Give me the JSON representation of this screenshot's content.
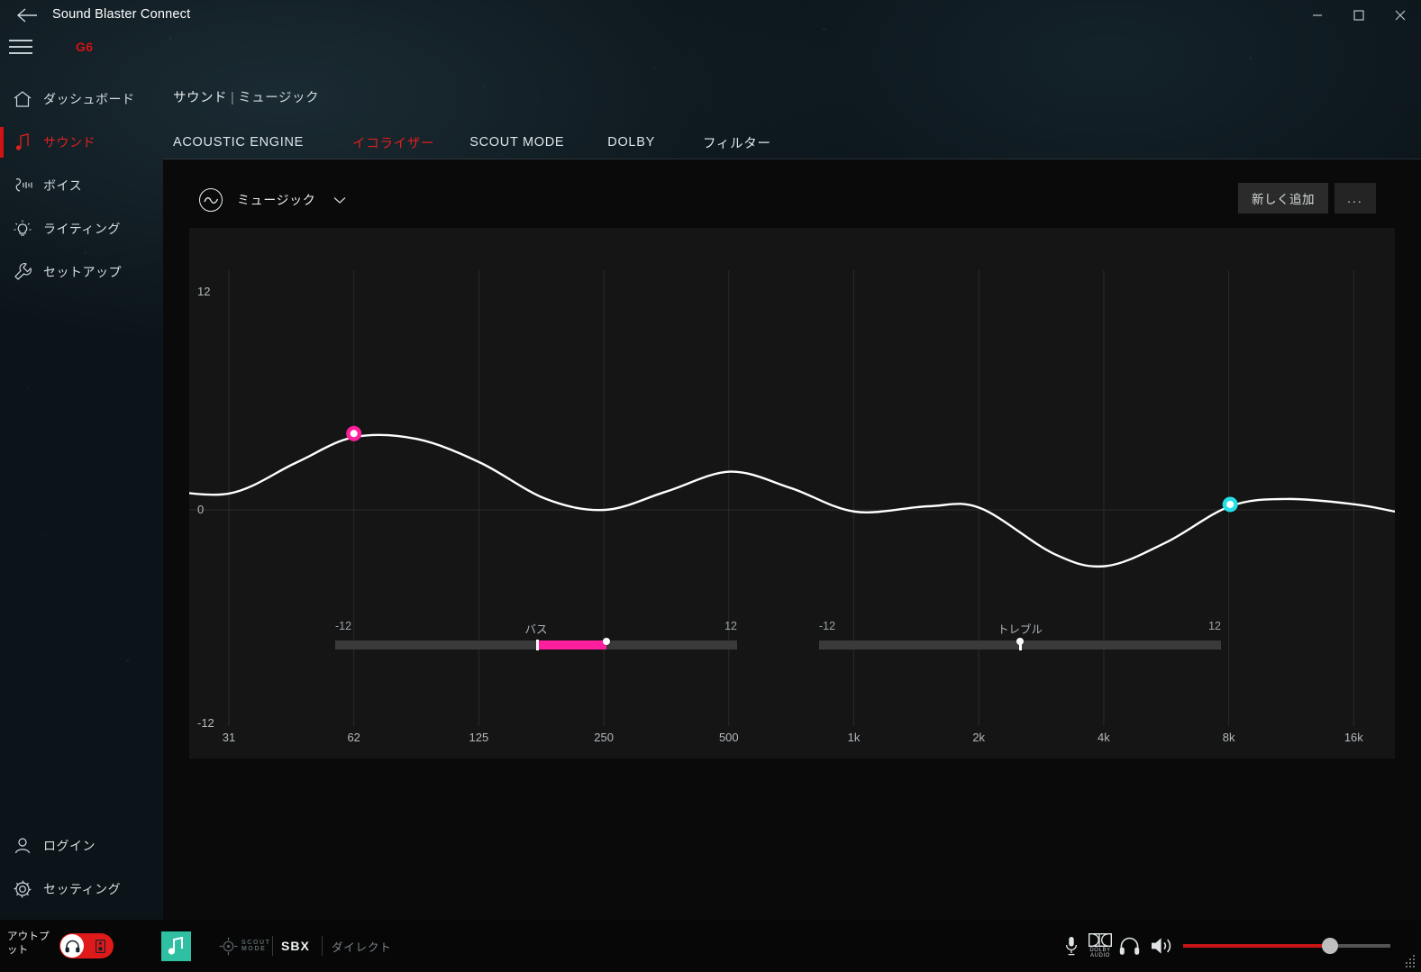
{
  "titlebar": {
    "app_title": "Sound Blaster Connect",
    "back_icon": "back-arrow-icon",
    "minimize": "–",
    "maximize": "□",
    "close": "✕"
  },
  "topbar": {
    "menu_icon": "hamburger-menu-icon",
    "device_label": "G6"
  },
  "sidebar": {
    "items": [
      {
        "label": "ダッシュボード",
        "icon": "home-icon",
        "active": false
      },
      {
        "label": "サウンド",
        "icon": "music-note-icon",
        "active": true
      },
      {
        "label": "ボイス",
        "icon": "microphone-wave-icon",
        "active": false
      },
      {
        "label": "ライティング",
        "icon": "lightbulb-icon",
        "active": false
      },
      {
        "label": "セットアップ",
        "icon": "wrench-icon",
        "active": false
      }
    ],
    "bottom_items": [
      {
        "label": "ログイン",
        "icon": "user-icon"
      },
      {
        "label": "セッティング",
        "icon": "gear-icon"
      }
    ]
  },
  "content": {
    "breadcrumb_root": "サウンド",
    "breadcrumb_separator": "|",
    "breadcrumb_current": "ミュージック",
    "tabs": [
      {
        "label": "ACOUSTIC ENGINE",
        "active": false
      },
      {
        "label": "イコライザー",
        "active": true
      },
      {
        "label": "SCOUT MODE",
        "active": false
      },
      {
        "label": "DOLBY",
        "active": false
      },
      {
        "label": "フィルター",
        "active": false
      }
    ],
    "preset": {
      "icon": "eq-wave-circle-icon",
      "name": "ミュージック",
      "caret_icon": "chevron-down-icon"
    },
    "add_button_label": "新しく追加",
    "more_button_label": "..."
  },
  "chart_data": {
    "type": "line",
    "title": "",
    "xlabel": "",
    "ylabel": "",
    "xtick_labels": [
      "31",
      "62",
      "125",
      "250",
      "500",
      "1k",
      "2k",
      "4k",
      "8k",
      "16k"
    ],
    "ytick_labels": [
      "12",
      "0",
      "-12"
    ],
    "ylim": [
      -12,
      12
    ],
    "grid": true,
    "zero_line": 0,
    "curve_points_db": [
      {
        "freq": "20",
        "db": 1.2
      },
      {
        "freq": "31",
        "db": 0.9
      },
      {
        "freq": "45",
        "db": 2.6
      },
      {
        "freq": "62",
        "db": 4.0
      },
      {
        "freq": "88",
        "db": 3.9
      },
      {
        "freq": "125",
        "db": 2.6
      },
      {
        "freq": "180",
        "db": 0.6
      },
      {
        "freq": "250",
        "db": 0.0
      },
      {
        "freq": "350",
        "db": 1.0
      },
      {
        "freq": "500",
        "db": 2.1
      },
      {
        "freq": "700",
        "db": 1.2
      },
      {
        "freq": "1k",
        "db": -0.1
      },
      {
        "freq": "1.5k",
        "db": 0.2
      },
      {
        "freq": "2k",
        "db": 0.1
      },
      {
        "freq": "3k",
        "db": -2.4
      },
      {
        "freq": "4k",
        "db": -3.1
      },
      {
        "freq": "5.6k",
        "db": -1.8
      },
      {
        "freq": "8k",
        "db": 0.2
      },
      {
        "freq": "11k",
        "db": 0.6
      },
      {
        "freq": "16k",
        "db": 0.3
      },
      {
        "freq": "20k",
        "db": -0.1
      }
    ],
    "handles": [
      {
        "name": "bass-band-handle",
        "freq": "62",
        "db": 4.2,
        "color": "#ff1f9c"
      },
      {
        "name": "treble-band-handle",
        "freq": "8k",
        "db": 0.3,
        "color": "#25e0e8"
      }
    ],
    "curve_color": "#ffffff",
    "grid_color": "#2b2b2b",
    "plot_bg": "#151515"
  },
  "sliders": {
    "bass": {
      "name": "バス",
      "min_label": "-12",
      "max_label": "12",
      "min": -12,
      "max": 12,
      "value": 4.2,
      "fill_color": "#ff1f9c"
    },
    "treble": {
      "name": "トレブル",
      "min_label": "-12",
      "max_label": "12",
      "min": -12,
      "max": 12,
      "value": 0,
      "fill_color": "#ffffff"
    }
  },
  "bottombar": {
    "output_label": "アウトプット",
    "output_toggle_on": true,
    "output_icon": "headphone-icon",
    "profile_tile_icon": "music-note-icon",
    "scout_mode_label": "SCOUT MODE",
    "scout_mode_icon": "scout-mode-crosshair-icon",
    "sbx_label": "SBX",
    "direct_label": "ダイレクト",
    "mic_icon": "microphone-icon",
    "dolby_icon": "dolby-audio-icon",
    "dolby_label_top": "DOLBY",
    "dolby_label_bottom": "AUDIO",
    "headphone_icon": "headphone-icon",
    "speaker_icon": "speaker-volume-icon",
    "volume_percent": 71,
    "volume_color": "#c71414",
    "resize_grip_icon": "resize-grip-icon"
  },
  "colors": {
    "accent_red": "#d01414",
    "active_tab": "#e02020",
    "magenta": "#ff1f9c",
    "cyan": "#25e0e8",
    "teal_tile": "#2fbfa3"
  }
}
